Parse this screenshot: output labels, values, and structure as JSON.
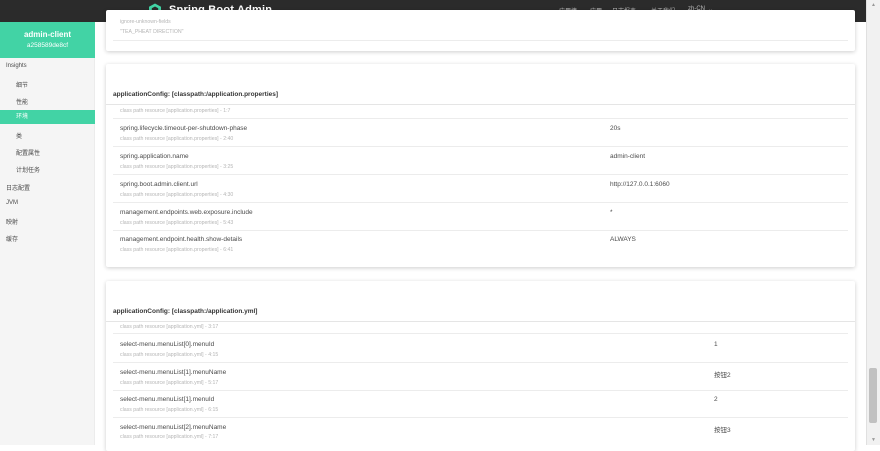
{
  "header": {
    "title": "Spring Boot Admin",
    "nav": [
      "应用墙",
      "应用",
      "日志报表",
      "关于我们"
    ],
    "language": "zh-CN"
  },
  "sidebar": {
    "app_name": "admin-client",
    "app_id": "a258589de8cf",
    "insights_label": "Insights",
    "insights_items": [
      "细节",
      "性能",
      "环境",
      "类",
      "配置属性",
      "计划任务"
    ],
    "active_item": "环境",
    "top_items": [
      "日志配置",
      "JVM",
      "映射",
      "缓存"
    ]
  },
  "top_card": {
    "origin_line1": "ignore-unknown-fields",
    "origin_line2": "\"TEA_PHEAT DIRECTION\""
  },
  "properties_card": {
    "title": "applicationConfig: [classpath:/application.properties]",
    "clipped_origin": "class path resource [application.properties] - 1:7",
    "rows": [
      {
        "name": "spring.lifecycle.timeout-per-shutdown-phase",
        "origin": "class path resource [application.properties] - 2:40",
        "value": "20s"
      },
      {
        "name": "spring.application.name",
        "origin": "class path resource [application.properties] - 3:25",
        "value": "admin-client"
      },
      {
        "name": "spring.boot.admin.client.url",
        "origin": "class path resource [application.properties] - 4:30",
        "value": "http://127.0.0.1:6060"
      },
      {
        "name": "management.endpoints.web.exposure.include",
        "origin": "class path resource [application.properties] - 5:43",
        "value": "*"
      },
      {
        "name": "management.endpoint.health.show-details",
        "origin": "class path resource [application.properties] - 6:41",
        "value": "ALWAYS"
      }
    ]
  },
  "yml_card": {
    "title": "applicationConfig: [classpath:/application.yml]",
    "clipped_origin": "class path resource [application.yml] - 3:17",
    "rows": [
      {
        "name": "select-menu.menuList[0].menuId",
        "origin": "class path resource [application.yml] - 4:15",
        "value": "1"
      },
      {
        "name": "select-menu.menuList[1].menuName",
        "origin": "class path resource [application.yml] - 5:17",
        "value": "按钮2"
      },
      {
        "name": "select-menu.menuList[1].menuId",
        "origin": "class path resource [application.yml] - 6:15",
        "value": "2"
      },
      {
        "name": "select-menu.menuList[2].menuName",
        "origin": "class path resource [application.yml] - 7:17",
        "value": "按钮3"
      }
    ]
  },
  "colors": {
    "accent": "#42d3a5",
    "navbar": "#2b2b2b"
  }
}
